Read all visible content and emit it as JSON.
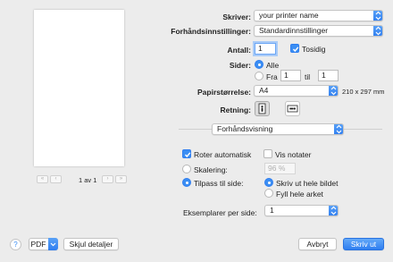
{
  "preview": {
    "page_indicator": "1 av 1",
    "first_page": "«",
    "prev_page": "‹",
    "next_page": "›",
    "last_page": "»"
  },
  "printer": {
    "label": "Skriver:",
    "value": "your printer name"
  },
  "presets": {
    "label": "Forhåndsinnstillinger:",
    "value": "Standardinnstillinger"
  },
  "copies": {
    "label": "Antall:",
    "value": "1",
    "two_sided_label": "Tosidig",
    "two_sided_checked": true
  },
  "pages": {
    "label": "Sider:",
    "all_label": "Alle",
    "from_label": "Fra",
    "from_value": "1",
    "to_label": "til",
    "to_value": "1",
    "selected": "all"
  },
  "paper_size": {
    "label": "Papirstørrelse:",
    "value": "A4",
    "dimensions": "210 x 297 mm"
  },
  "orientation": {
    "label": "Retning:",
    "selected": "portrait"
  },
  "section_menu": {
    "value": "Forhåndsvisning"
  },
  "options": {
    "auto_rotate_label": "Roter automatisk",
    "auto_rotate_checked": true,
    "show_notes_label": "Vis notater",
    "show_notes_checked": false,
    "scaling_label": "Skalering:",
    "scaling_value": "96 %",
    "fit_label": "Tilpass til side:",
    "fit_selected": true,
    "print_entire_label": "Skriv ut hele bildet",
    "fill_sheet_label": "Fyll hele arket",
    "fit_mode": "print_entire"
  },
  "per_sheet": {
    "label": "Eksemplarer per side:",
    "value": "1"
  },
  "footer": {
    "help": "?",
    "pdf_label": "PDF",
    "hide_details_label": "Skjul detaljer",
    "cancel_label": "Avbryt",
    "print_label": "Skriv ut"
  },
  "colors": {
    "accent": "#3b8ef3",
    "background": "#ececec"
  }
}
